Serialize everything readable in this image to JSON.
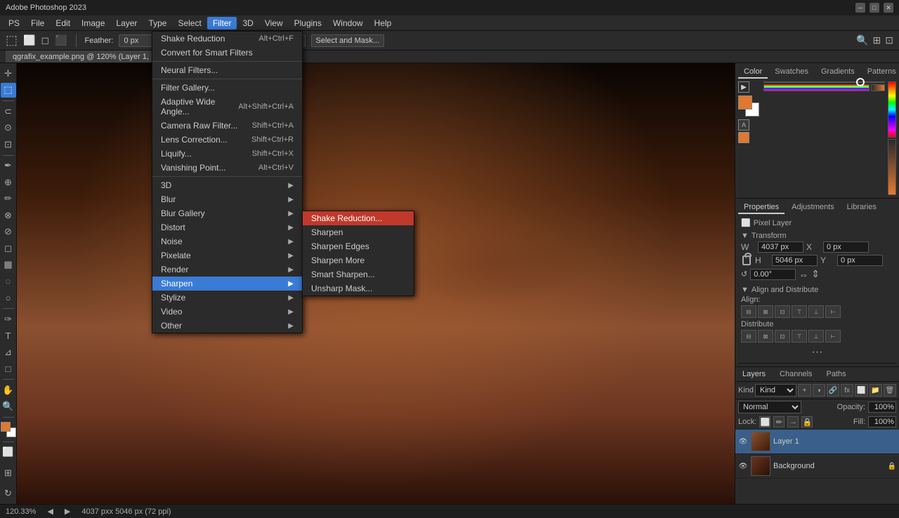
{
  "titlebar": {
    "title": "Adobe Photoshop 2023",
    "buttons": [
      "minimize",
      "maximize",
      "close"
    ]
  },
  "menubar": {
    "items": [
      "PS",
      "File",
      "Edit",
      "Image",
      "Layer",
      "Type",
      "Select",
      "Filter",
      "3D",
      "View",
      "Plugins",
      "Window",
      "Help"
    ],
    "active": "Filter"
  },
  "optionsbar": {
    "feather": "Feather:",
    "feather_value": "0 px",
    "select_mask_btn": "Select and Mask..."
  },
  "canvas": {
    "filename": "qgrafix_example.png @ 120% (Layer 1, ",
    "zoom": "120.33%",
    "dimensions": "4037 pxx 5046 px (72 ppi)"
  },
  "filter_menu": {
    "items": [
      {
        "label": "Shake Reduction",
        "shortcut": "Alt+Ctrl+F",
        "type": "item",
        "highlighted": false
      },
      {
        "label": "Convert for Smart Filters",
        "shortcut": "",
        "type": "item",
        "highlighted": false
      },
      {
        "label": "Neural Filters...",
        "shortcut": "",
        "type": "item",
        "highlighted": false,
        "disabled": false
      },
      {
        "label": "separator1",
        "type": "separator"
      },
      {
        "label": "Filter Gallery...",
        "shortcut": "",
        "type": "item",
        "highlighted": false
      },
      {
        "label": "Adaptive Wide Angle...",
        "shortcut": "Alt+Shift+Ctrl+A",
        "type": "item",
        "highlighted": false
      },
      {
        "label": "Camera Raw Filter...",
        "shortcut": "Shift+Ctrl+A",
        "type": "item",
        "highlighted": false
      },
      {
        "label": "Lens Correction...",
        "shortcut": "Shift+Ctrl+R",
        "type": "item",
        "highlighted": false
      },
      {
        "label": "Liquify...",
        "shortcut": "Shift+Ctrl+X",
        "type": "item",
        "highlighted": false
      },
      {
        "label": "Vanishing Point...",
        "shortcut": "Alt+Ctrl+V",
        "type": "item",
        "highlighted": false
      },
      {
        "label": "separator2",
        "type": "separator"
      },
      {
        "label": "3D",
        "shortcut": "",
        "type": "submenu",
        "highlighted": false
      },
      {
        "label": "Blur",
        "shortcut": "",
        "type": "submenu",
        "highlighted": false
      },
      {
        "label": "Blur Gallery",
        "shortcut": "",
        "type": "submenu",
        "highlighted": false
      },
      {
        "label": "Distort",
        "shortcut": "",
        "type": "submenu",
        "highlighted": false
      },
      {
        "label": "Noise",
        "shortcut": "",
        "type": "submenu",
        "highlighted": false
      },
      {
        "label": "Pixelate",
        "shortcut": "",
        "type": "submenu",
        "highlighted": false
      },
      {
        "label": "Render",
        "shortcut": "",
        "type": "submenu",
        "highlighted": false
      },
      {
        "label": "Sharpen",
        "shortcut": "",
        "type": "submenu",
        "highlighted": true
      },
      {
        "label": "Stylize",
        "shortcut": "",
        "type": "submenu",
        "highlighted": false
      },
      {
        "label": "Video",
        "shortcut": "",
        "type": "submenu",
        "highlighted": false
      },
      {
        "label": "Other",
        "shortcut": "",
        "type": "submenu",
        "highlighted": false
      }
    ]
  },
  "sharpen_submenu": {
    "items": [
      {
        "label": "Shake Reduction...",
        "highlighted": true
      },
      {
        "label": "Sharpen",
        "highlighted": false
      },
      {
        "label": "Sharpen Edges",
        "highlighted": false
      },
      {
        "label": "Sharpen More",
        "highlighted": false
      },
      {
        "label": "Smart Sharpen...",
        "highlighted": false
      },
      {
        "label": "Unsharp Mask...",
        "highlighted": false
      }
    ]
  },
  "color_panel": {
    "tabs": [
      "Color",
      "Swatches",
      "Gradients",
      "Patterns"
    ],
    "active_tab": "Color"
  },
  "properties_panel": {
    "tabs": [
      "Properties",
      "Adjustments",
      "Libraries"
    ],
    "active_tab": "Properties",
    "layer_type": "Pixel Layer",
    "transform": {
      "title": "Transform",
      "w_label": "W",
      "w_value": "4037 px",
      "x_label": "X",
      "x_value": "0 px",
      "h_label": "H",
      "h_value": "5046 px",
      "y_label": "Y",
      "y_value": "0 px",
      "angle_value": "0.00°"
    },
    "align_distribute": {
      "title": "Align and Distribute",
      "align_label": "Align:",
      "distribute_label": "Distribute"
    }
  },
  "layers_panel": {
    "tabs": [
      "Layers",
      "Channels",
      "Paths"
    ],
    "active_tab": "Layers",
    "blend_mode": "Normal",
    "opacity_label": "Opacity:",
    "opacity_value": "100%",
    "fill_label": "Fill:",
    "fill_value": "100%",
    "lock_label": "Lock:",
    "layers": [
      {
        "name": "Layer 1",
        "visible": true,
        "active": true,
        "locked": false
      },
      {
        "name": "Background",
        "visible": true,
        "active": false,
        "locked": true
      }
    ]
  },
  "statusbar": {
    "zoom": "120.33%",
    "info": "4037 pxx 5046 px (72 ppi)"
  }
}
